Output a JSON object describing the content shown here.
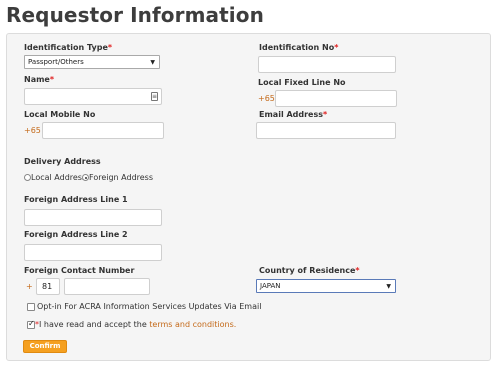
{
  "page": {
    "title": "Requestor Information"
  },
  "form": {
    "id_type": {
      "label": "Identification Type",
      "required_mark": "*",
      "value": "Passport/Others"
    },
    "id_no": {
      "label": "Identification No",
      "required_mark": "*",
      "value": ""
    },
    "name": {
      "label": "Name",
      "required_mark": "*",
      "value": ""
    },
    "fixed_line": {
      "label": "Local Fixed Line No",
      "prefix": "+65",
      "value": ""
    },
    "mobile": {
      "label": "Local Mobile No",
      "prefix": "+65",
      "value": ""
    },
    "email": {
      "label": "Email Address",
      "required_mark": "*",
      "value": ""
    },
    "delivery": {
      "label": "Delivery Address",
      "options": [
        "Local Address",
        "Foreign Address"
      ],
      "selected": "Foreign Address"
    },
    "foreign_line1": {
      "label": "Foreign Address Line 1",
      "value": ""
    },
    "foreign_line2": {
      "label": "Foreign Address Line 2",
      "value": ""
    },
    "foreign_contact": {
      "label": "Foreign Contact Number",
      "plus": "+",
      "code": "81",
      "value": ""
    },
    "country": {
      "label": "Country of Residence",
      "required_mark": "*",
      "value": "JAPAN"
    },
    "optin": {
      "label": "Opt-in For ACRA Information Services Updates Via Email",
      "checked": false
    },
    "terms": {
      "prefix_mark": "*",
      "label": "I have read and accept the ",
      "link": "terms and conditions.",
      "checked": true
    },
    "confirm_label": "Confirm"
  }
}
